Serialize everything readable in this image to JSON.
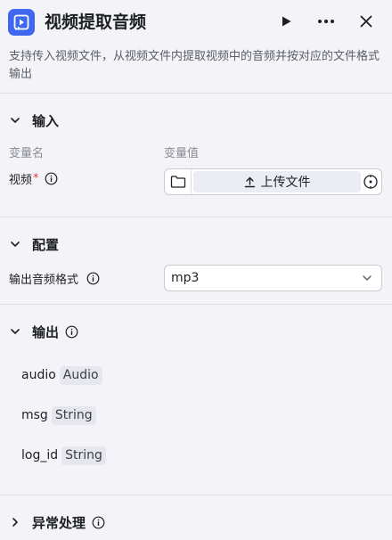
{
  "header": {
    "title": "视频提取音频",
    "description": "支持传入视频文件，从视频文件内提取视频中的音频并按对应的文件格式输出",
    "icons": {
      "app": "video-audio-icon",
      "run": "play-icon",
      "more": "more-icon",
      "close": "close-icon"
    }
  },
  "input_section": {
    "title": "输入",
    "col_name": "变量名",
    "col_value": "变量值",
    "field": {
      "label": "视频",
      "required_mark": "*",
      "upload_label": "上传文件"
    }
  },
  "config_section": {
    "title": "配置",
    "field_label": "输出音频格式",
    "selected_value": "mp3"
  },
  "output_section": {
    "title": "输出",
    "items": [
      {
        "name": "audio",
        "type": "Audio"
      },
      {
        "name": "msg",
        "type": "String"
      },
      {
        "name": "log_id",
        "type": "String"
      }
    ]
  },
  "error_section": {
    "title": "异常处理"
  },
  "colors": {
    "accent": "#3f68ee",
    "required": "#e5383b",
    "background": "#f3f3f8"
  }
}
